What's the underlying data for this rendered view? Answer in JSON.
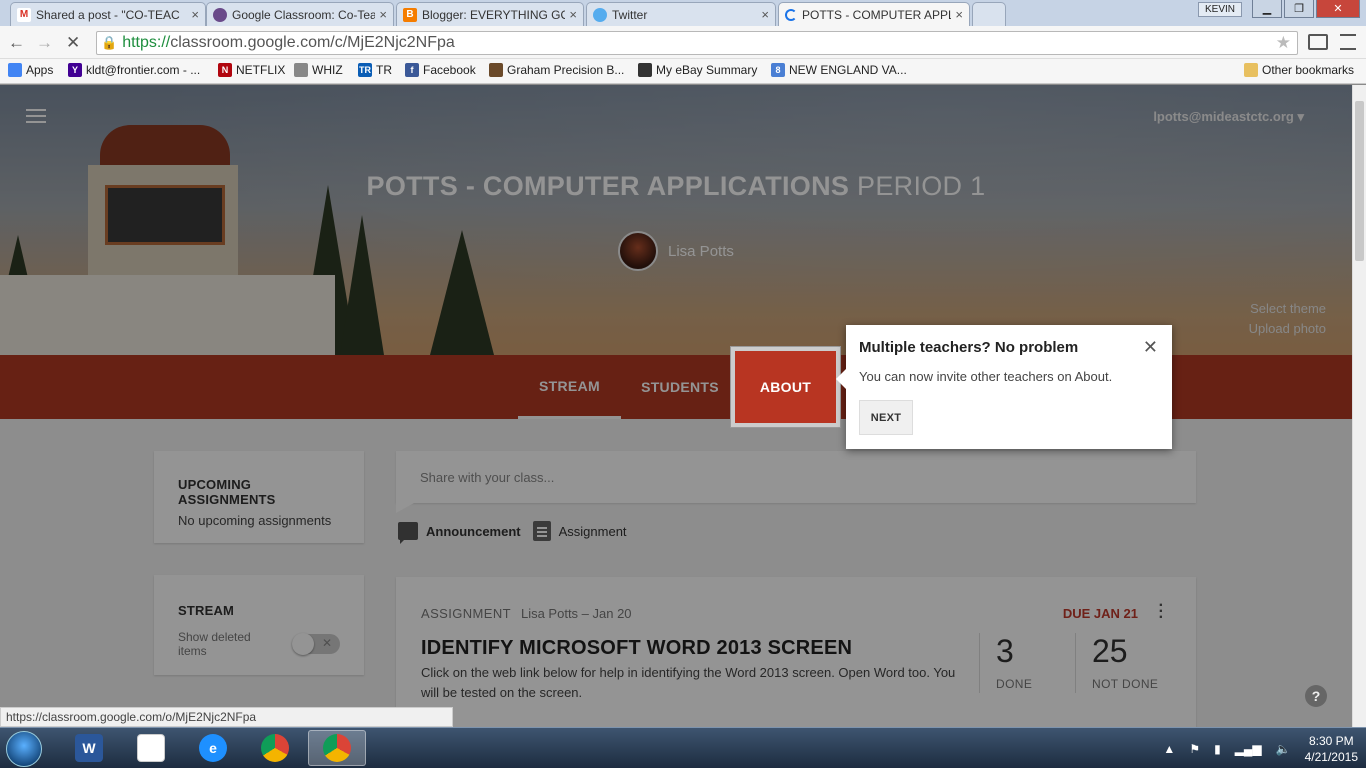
{
  "browser": {
    "tabs": [
      {
        "title": "Shared a post - \"CO-TEAC",
        "favicon": "gmail-icon",
        "color": "#d93025"
      },
      {
        "title": "Google Classroom: Co-Tea",
        "favicon": "classroom-icon",
        "color": "#6a4a8a"
      },
      {
        "title": "Blogger: EVERYTHING GO",
        "favicon": "blogger-icon",
        "color": "#f57d00"
      },
      {
        "title": "Twitter",
        "favicon": "twitter-icon",
        "color": "#55acee"
      },
      {
        "title": "POTTS - COMPUTER APPL",
        "favicon": "loading-icon",
        "color": "#1a73e8"
      }
    ],
    "user_badge": "KEVIN",
    "url_scheme": "https://",
    "url_rest": "classroom.google.com/c/MjE2Njc2NFpa",
    "bookmarks": [
      {
        "label": "Apps",
        "icon": "apps-grid-icon",
        "color": "#4285f4"
      },
      {
        "label": "kldt@frontier.com - ...",
        "icon": "yahoo-icon",
        "color": "#410093"
      },
      {
        "label": "NETFLIX",
        "icon": "netflix-icon",
        "color": "#b1060f"
      },
      {
        "label": "WHIZ",
        "icon": "nbc-peacock-icon",
        "color": "#888888"
      },
      {
        "label": "TR",
        "icon": "tr-icon",
        "color": "#0a5db5"
      },
      {
        "label": "Facebook",
        "icon": "facebook-icon",
        "color": "#3b5998"
      },
      {
        "label": "Graham Precision B...",
        "icon": "hammer-icon",
        "color": "#6b4a2a"
      },
      {
        "label": "My eBay Summary",
        "icon": "ebay-icon",
        "color": "#333333"
      },
      {
        "label": "NEW ENGLAND VA...",
        "icon": "google-icon",
        "color": "#4a7fd4"
      }
    ],
    "other_bookmarks": "Other bookmarks",
    "status_url": "https://classroom.google.com/o/MjE2Njc2NFpa"
  },
  "header": {
    "user_email": "lpotts@mideastctc.org",
    "class_title_main": "POTTS - COMPUTER APPLICATIONS",
    "class_title_period": "PERIOD 1",
    "teacher_name": "Lisa Potts",
    "select_theme": "Select theme",
    "upload_photo": "Upload photo"
  },
  "tabs": {
    "stream": "STREAM",
    "students": "STUDENTS",
    "about": "ABOUT"
  },
  "popup": {
    "title": "Multiple teachers? No problem",
    "message": "You can now invite other teachers on About.",
    "next": "NEXT"
  },
  "sidebar": {
    "upcoming_title": "UPCOMING ASSIGNMENTS",
    "upcoming_empty": "No upcoming assignments",
    "stream_title": "STREAM",
    "show_deleted": "Show deleted items"
  },
  "share": {
    "placeholder": "Share with your class...",
    "announcement": "Announcement",
    "assignment": "Assignment"
  },
  "assignment_card": {
    "type": "ASSIGNMENT",
    "author_date": "Lisa Potts – Jan 20",
    "due": "DUE JAN 21",
    "title": "IDENTIFY MICROSOFT WORD 2013 SCREEN",
    "description": "Click on the web link below for help in identifying the Word 2013 screen. Open Word too. You will be tested on the screen.",
    "done_count": "3",
    "done_label": "DONE",
    "not_done_count": "25",
    "not_done_label": "NOT DONE"
  },
  "taskbar": {
    "time": "8:30 PM",
    "date": "4/21/2015"
  }
}
